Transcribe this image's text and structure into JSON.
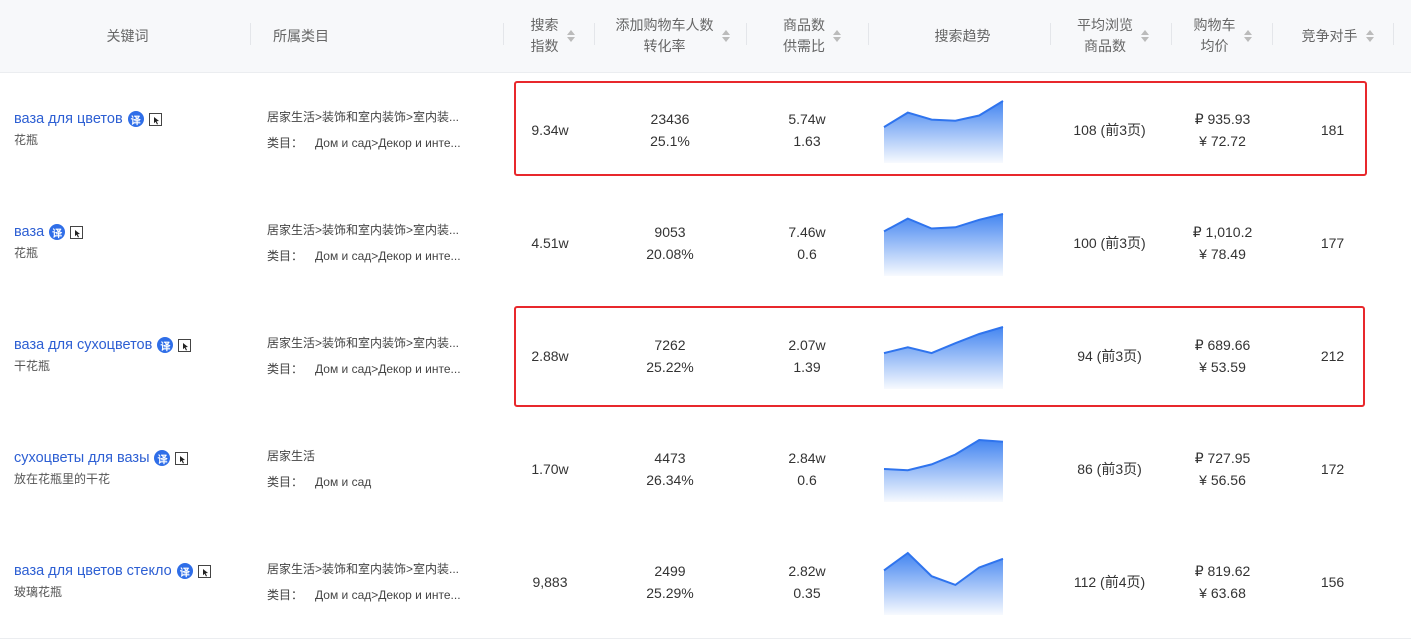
{
  "header": {
    "keyword": "关键词",
    "category": "所属类目",
    "search_index": [
      "搜索",
      "指数"
    ],
    "cart": [
      "添加购物车人数",
      "转化率"
    ],
    "supply": [
      "商品数",
      "供需比"
    ],
    "trend": "搜索趋势",
    "browse": [
      "平均浏览",
      "商品数"
    ],
    "price": [
      "购物车",
      "均价"
    ],
    "competitors": "竞争对手"
  },
  "colors": {
    "link": "#2d5fd3",
    "badge": "#2f6ee8",
    "trend": "#3a7ff0",
    "highlight": "#e8282c"
  },
  "icons": {
    "badge": "translate-badge-icon",
    "cursor": "cursor-icon",
    "sort": "sort-icon"
  },
  "rows": [
    {
      "keyword": "ваза для цветов",
      "badge": "译",
      "translation": "花瓶",
      "cat_line1": "居家生活>装饰和室内装饰>室内装...",
      "cat_prefix": "类目：",
      "cat_line2": "Дом и сад>Декор и инте...",
      "search_index": "9.34w",
      "cart_count": "23436",
      "cart_rate": "25.1%",
      "products": "5.74w",
      "supply_ratio": "1.63",
      "browse": "108 (前3页)",
      "price_rub": "₽ 935.93",
      "price_cny": "¥ 72.72",
      "competitors": "181",
      "trend": [
        0.55,
        0.8,
        0.68,
        0.66,
        0.75,
        1.0
      ]
    },
    {
      "keyword": "ваза",
      "badge": "译",
      "translation": "花瓶",
      "cat_line1": "居家生活>装饰和室内装饰>室内装...",
      "cat_prefix": "类目：",
      "cat_line2": "Дом и сад>Декор и инте...",
      "search_index": "4.51w",
      "cart_count": "9053",
      "cart_rate": "20.08%",
      "products": "7.46w",
      "supply_ratio": "0.6",
      "browse": "100 (前3页)",
      "price_rub": "₽ 1,010.2",
      "price_cny": "¥ 78.49",
      "competitors": "177",
      "trend": [
        0.7,
        0.92,
        0.75,
        0.77,
        0.9,
        1.0
      ]
    },
    {
      "keyword": "ваза для сухоцветов",
      "badge": "译",
      "translation": "干花瓶",
      "cat_line1": "居家生活>装饰和室内装饰>室内装...",
      "cat_prefix": "类目：",
      "cat_line2": "Дом и сад>Декор и инте...",
      "search_index": "2.88w",
      "cart_count": "7262",
      "cart_rate": "25.22%",
      "products": "2.07w",
      "supply_ratio": "1.39",
      "browse": "94 (前3页)",
      "price_rub": "₽ 689.66",
      "price_cny": "¥ 53.59",
      "competitors": "212",
      "trend": [
        0.55,
        0.65,
        0.55,
        0.72,
        0.88,
        1.0
      ]
    },
    {
      "keyword": "сухоцветы для вазы",
      "badge": "译",
      "translation": "放在花瓶里的干花",
      "cat_line1": "居家生活",
      "cat_prefix": "类目：",
      "cat_line2": "Дом и сад",
      "search_index": "1.70w",
      "cart_count": "4473",
      "cart_rate": "26.34%",
      "products": "2.84w",
      "supply_ratio": "0.6",
      "browse": "86 (前3页)",
      "price_rub": "₽ 727.95",
      "price_cny": "¥ 56.56",
      "competitors": "172",
      "trend": [
        0.5,
        0.48,
        0.58,
        0.75,
        1.0,
        0.97
      ]
    },
    {
      "keyword": "ваза для цветов стекло",
      "badge": "译",
      "translation": "玻璃花瓶",
      "cat_line1": "居家生活>装饰和室内装饰>室内装...",
      "cat_prefix": "类目：",
      "cat_line2": "Дом и сад>Декор и инте...",
      "search_index": "9,883",
      "cart_count": "2499",
      "cart_rate": "25.29%",
      "products": "2.82w",
      "supply_ratio": "0.35",
      "browse": "112 (前4页)",
      "price_rub": "₽ 819.62",
      "price_cny": "¥ 63.68",
      "competitors": "156",
      "trend": [
        0.7,
        1.0,
        0.6,
        0.45,
        0.75,
        0.9
      ]
    }
  ]
}
